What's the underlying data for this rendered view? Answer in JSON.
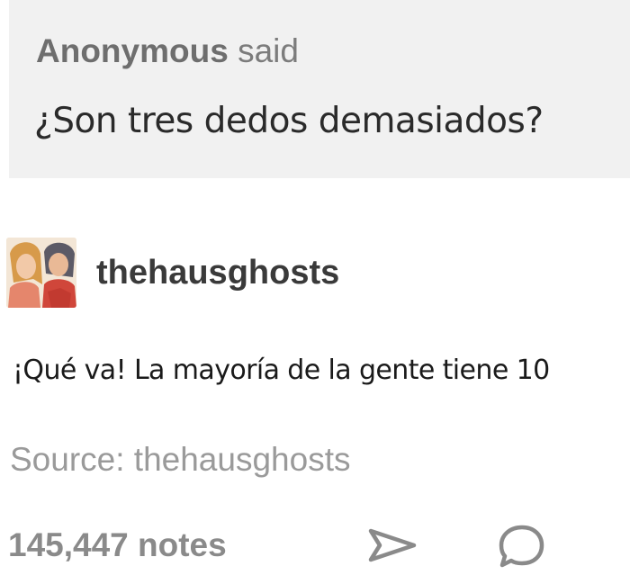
{
  "ask": {
    "asker": "Anonymous",
    "said": "said",
    "question": "¿Son tres dedos demasiados?"
  },
  "answerer": {
    "avatar_icon": "avatar-illustration",
    "blog_name": "thehausghosts"
  },
  "answer": {
    "text": "¡Qué va! La mayoría de la gente tiene 10"
  },
  "footer": {
    "source_label": "Source:",
    "source_name": "thehausghosts",
    "notes": "145,447 notes",
    "share_icon": "share-icon",
    "reply_icon": "reply-icon"
  },
  "colors": {
    "ask_background": "#f1f1f1",
    "muted_text": "#8a8a8a",
    "body_text": "#1a1a1a"
  }
}
